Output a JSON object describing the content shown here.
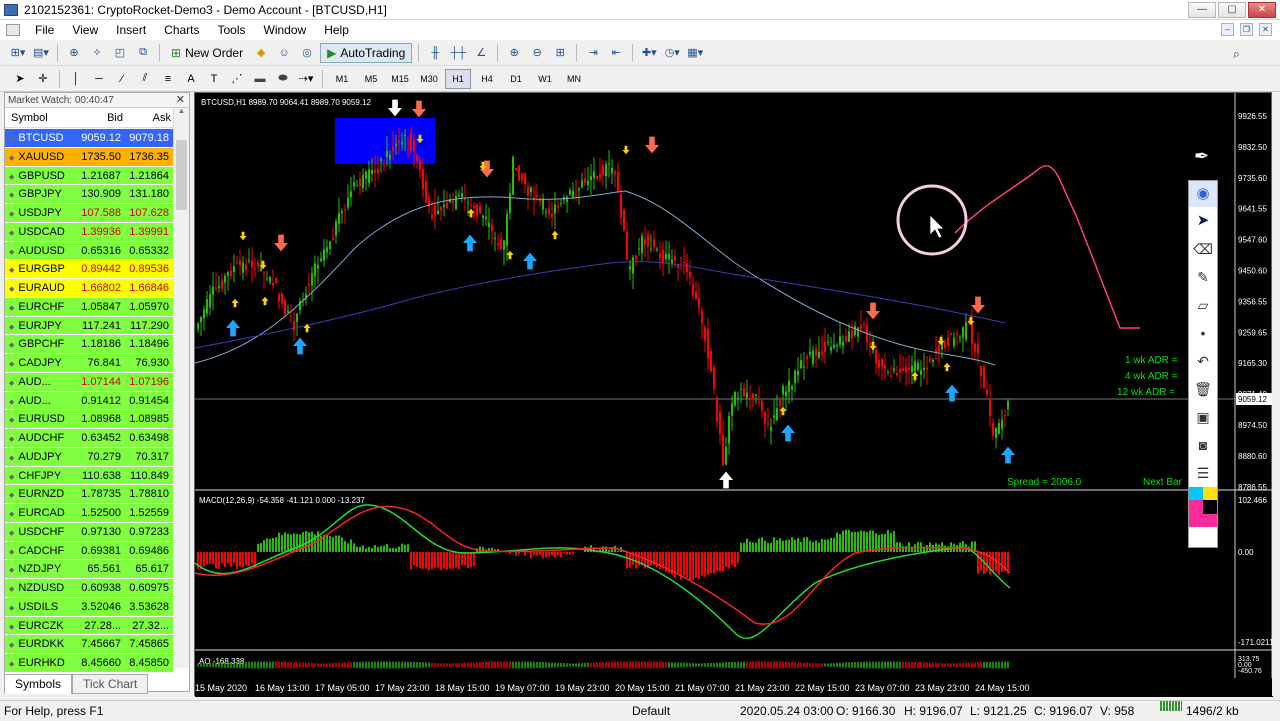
{
  "window": {
    "title": "2102152361: CryptoRocket-Demo3 - Demo Account - [BTCUSD,H1]",
    "btn_min": "—",
    "btn_max": "▢",
    "btn_close": "✕"
  },
  "menu": [
    "File",
    "View",
    "Insert",
    "Charts",
    "Tools",
    "Window",
    "Help"
  ],
  "toolbar": {
    "new_order": "New Order",
    "autotrading": "AutoTrading",
    "timeframes": [
      "M1",
      "M5",
      "M15",
      "M30",
      "H1",
      "H4",
      "D1",
      "W1",
      "MN"
    ],
    "active_timeframe": "H1"
  },
  "market_watch": {
    "title": "Market Watch: 00:40:47",
    "headers": [
      "Symbol",
      "Bid",
      "Ask"
    ],
    "rows": [
      {
        "symbol": "BTCUSD",
        "bid": "9059.12",
        "ask": "9079.18",
        "style": "sel"
      },
      {
        "symbol": "XAUUSD",
        "bid": "1735.50",
        "ask": "1736.35",
        "style": "gold"
      },
      {
        "symbol": "GBPUSD",
        "bid": "1.21687",
        "ask": "1.21864",
        "style": ""
      },
      {
        "symbol": "GBPJPY",
        "bid": "130.909",
        "ask": "131.180",
        "style": ""
      },
      {
        "symbol": "USDJPY",
        "bid": "107.588",
        "ask": "107.628",
        "style": "red"
      },
      {
        "symbol": "USDCAD",
        "bid": "1.39936",
        "ask": "1.39991",
        "style": "red"
      },
      {
        "symbol": "AUDUSD",
        "bid": "0.65316",
        "ask": "0.65332",
        "style": ""
      },
      {
        "symbol": "EURGBP",
        "bid": "0.89442",
        "ask": "0.89536",
        "style": "yel"
      },
      {
        "symbol": "EURAUD",
        "bid": "1.66802",
        "ask": "1.66846",
        "style": "yel"
      },
      {
        "symbol": "EURCHF",
        "bid": "1.05847",
        "ask": "1.05970",
        "style": ""
      },
      {
        "symbol": "EURJPY",
        "bid": "117.241",
        "ask": "117.290",
        "style": ""
      },
      {
        "symbol": "GBPCHF",
        "bid": "1.18186",
        "ask": "1.18496",
        "style": ""
      },
      {
        "symbol": "CADJPY",
        "bid": "76.841",
        "ask": "76.930",
        "style": ""
      },
      {
        "symbol": "AUD...",
        "bid": "1.07144",
        "ask": "1.07196",
        "style": "red"
      },
      {
        "symbol": "AUD...",
        "bid": "0.91412",
        "ask": "0.91454",
        "style": ""
      },
      {
        "symbol": "EURUSD",
        "bid": "1.08968",
        "ask": "1.08985",
        "style": ""
      },
      {
        "symbol": "AUDCHF",
        "bid": "0.63452",
        "ask": "0.63498",
        "style": ""
      },
      {
        "symbol": "AUDJPY",
        "bid": "70.279",
        "ask": "70.317",
        "style": ""
      },
      {
        "symbol": "CHFJPY",
        "bid": "110.638",
        "ask": "110.849",
        "style": ""
      },
      {
        "symbol": "EURNZD",
        "bid": "1.78735",
        "ask": "1.78810",
        "style": ""
      },
      {
        "symbol": "EURCAD",
        "bid": "1.52500",
        "ask": "1.52559",
        "style": ""
      },
      {
        "symbol": "USDCHF",
        "bid": "0.97130",
        "ask": "0.97233",
        "style": ""
      },
      {
        "symbol": "CADCHF",
        "bid": "0.69381",
        "ask": "0.69486",
        "style": ""
      },
      {
        "symbol": "NZDJPY",
        "bid": "65.561",
        "ask": "65.617",
        "style": ""
      },
      {
        "symbol": "NZDUSD",
        "bid": "0.60938",
        "ask": "0.60975",
        "style": ""
      },
      {
        "symbol": "USDILS",
        "bid": "3.52046",
        "ask": "3.53628",
        "style": ""
      },
      {
        "symbol": "EURCZK",
        "bid": "27.28...",
        "ask": "27.32...",
        "style": ""
      },
      {
        "symbol": "EURDKK",
        "bid": "7.45667",
        "ask": "7.45865",
        "style": ""
      },
      {
        "symbol": "EURHKD",
        "bid": "8.45660",
        "ask": "8.45850",
        "style": ""
      }
    ],
    "tabs": [
      "Symbols",
      "Tick Chart"
    ]
  },
  "chart": {
    "header": "BTCUSD,H1  8989.70 9064.41 8989.70 9059.12",
    "price_ticks": [
      "9926.55",
      "9832.50",
      "9735.60",
      "9641.55",
      "9547.60",
      "9450.60",
      "9356.55",
      "9259.65",
      "9165.30",
      "9071.40",
      "8974.50",
      "8880.60",
      "8786.55"
    ],
    "current_price": "9059.12",
    "adr_labels": [
      "1 wk ADR =",
      "4 wk ADR =",
      "12 wk ADR ="
    ],
    "spread": "Spread = 2006.0",
    "next_bar": "Next Bar",
    "macd_label": "MACD(12,26,9) -54.358 -41.121 0.000 -13.237",
    "macd_ticks": [
      "102.466",
      "0.00",
      "-171.0211"
    ],
    "ao_label": "AO -168.338",
    "ao_ticks": [
      "313.75",
      "0.00",
      "-450.76"
    ],
    "date_labels": [
      "15 May 2020",
      "16 May 13:00",
      "17 May 05:00",
      "17 May 23:00",
      "18 May 15:00",
      "19 May 07:00",
      "19 May 23:00",
      "20 May 15:00",
      "21 May 07:00",
      "21 May 23:00",
      "22 May 15:00",
      "23 May 07:00",
      "23 May 23:00",
      "24 May 15:00"
    ]
  },
  "status": {
    "help": "For Help, press F1",
    "profile": "Default",
    "datetime": "2020.05.24 03:00",
    "open": "O: 9166.30",
    "high": "H: 9196.07",
    "low": "L: 9121.25",
    "close": "C: 9196.07",
    "volume": "V: 958",
    "traffic": "1496/2 kb"
  },
  "colors": {
    "bull": "#22c000",
    "bear": "#ff0000",
    "ma_fast": "#7fa9d0",
    "ma_slow": "#3a3ab8",
    "forecast": "#ff3a8a",
    "adr_text": "#00e000"
  }
}
